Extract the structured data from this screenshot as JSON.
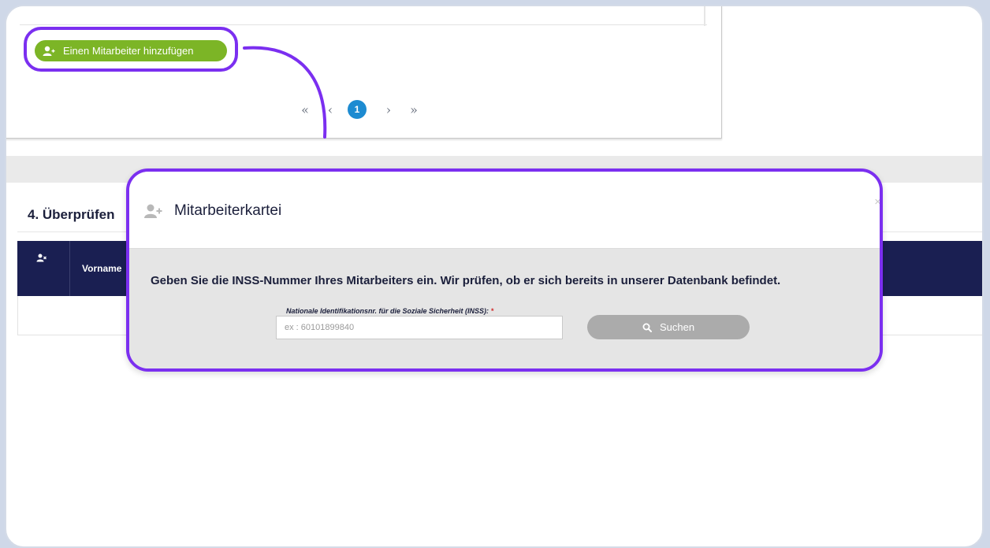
{
  "background_color": "#cfd8e8",
  "accent_color": "#7b2ff0",
  "top_card": {
    "add_button": {
      "label": "Einen Mitarbeiter hinzufügen",
      "icon": "add-user-icon",
      "color": "#7cb526"
    },
    "pagination": {
      "first": "«",
      "prev": "‹",
      "current": "1",
      "next": "›",
      "last": "»",
      "current_color": "#1d8bd1"
    }
  },
  "section": {
    "title": "4. Überprüfen",
    "table": {
      "icon": "remove-user-icon",
      "columns": [
        "Vorname"
      ],
      "header_color": "#1a1f52"
    }
  },
  "modal": {
    "icon": "add-user-icon",
    "title": "Mitarbeiterkartei",
    "close": "×",
    "instruction": "Geben Sie die INSS-Nummer Ihres Mitarbeiters ein. Wir prüfen, ob er sich bereits in unserer Datenbank befindet.",
    "field_label": "Nationale Identifikationsnr. für die Soziale Sicherheit (INSS):",
    "required_mark": "*",
    "input_placeholder": "ex : 60101899840",
    "input_value": "",
    "search_button": {
      "label": "Suchen",
      "icon": "search-icon"
    }
  }
}
